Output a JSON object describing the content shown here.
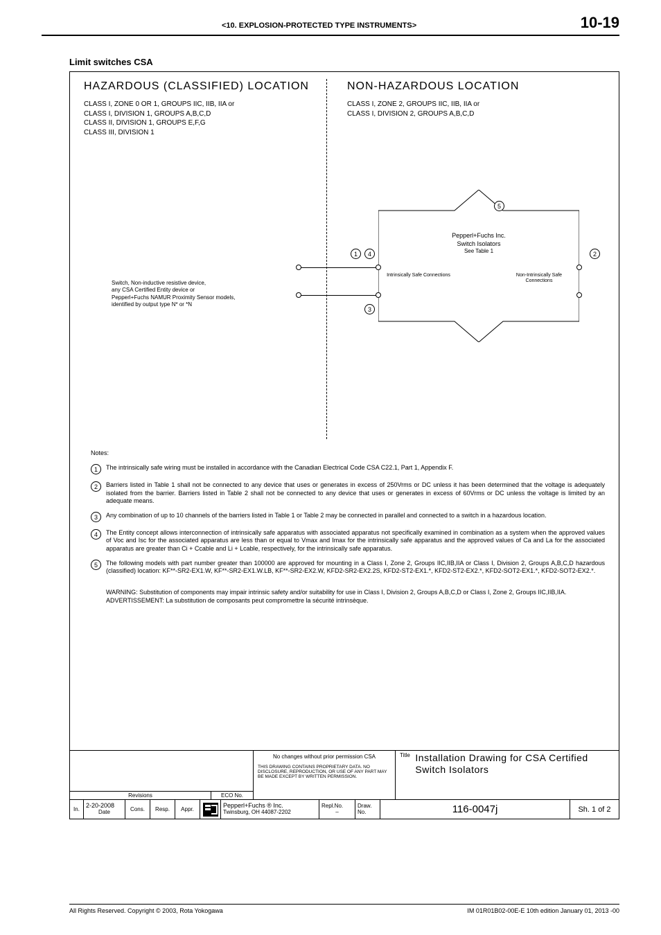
{
  "header": {
    "section": "<10. EXPLOSION-PROTECTED TYPE INSTRUMENTS>",
    "page": "10-19"
  },
  "title": "Limit switches CSA",
  "diagram": {
    "left_title": "HAZARDOUS (CLASSIFIED) LOCATION",
    "left_classes": [
      "CLASS I, ZONE 0 OR 1, GROUPS IIC, IIB, IIA or",
      "CLASS I, DIVISION 1, GROUPS A,B,C,D",
      "CLASS II, DIVISION 1, GROUPS E,F,G",
      "CLASS III, DIVISION 1"
    ],
    "switch_desc": [
      "Switch, Non-inductive resistive device,",
      "any CSA Certified Entity device or",
      "Pepperl+Fuchs NAMUR Proximity Sensor models,",
      "identified by output type N* or *N"
    ],
    "right_title": "NON-HAZARDOUS LOCATION",
    "right_classes": [
      "CLASS I, ZONE 2, GROUPS IIC, IIB, IIA or",
      "CLASS I, DIVISION 2, GROUPS A,B,C,D"
    ],
    "iso_line1": "Pepperl+Fuchs Inc.",
    "iso_line2": "Switch Isolators",
    "iso_see": "See Table 1",
    "conn_left": "Intrinsically Safe Connections",
    "conn_right": "Non-Intrinsically Safe Connections",
    "callouts": {
      "c1": "1",
      "c2": "2",
      "c3": "3",
      "c4": "4",
      "c5": "5"
    }
  },
  "notes": {
    "title": "Notes:",
    "items": [
      {
        "n": "1",
        "t": "The intrinsically safe wiring must be installed in accordance with the Canadian Electrical Code CSA C22.1, Part 1, Appendix F."
      },
      {
        "n": "2",
        "t": "Barriers listed in Table 1 shall not be connected to any device that uses or generates in excess of 250Vrms or DC unless it has been determined that the voltage is adequately isolated from the barrier. Barriers listed in Table 2 shall not be connected to any device that uses or generates in excess of 60Vrms or DC unless the voltage is limited by an adequate means."
      },
      {
        "n": "3",
        "t": "Any combination of up to 10 channels of the barriers listed in Table 1 or Table 2 may be connected in parallel and connected to a switch in a hazardous location."
      },
      {
        "n": "4",
        "t": "The Entity concept allows interconnection of intrinsically safe apparatus with associated apparatus not specifically examined in combination as a system when the approved values of Voc and Isc for the associated apparatus are less than or equal to Vmax and Imax for the intrinsically safe apparatus and the approved values of Ca and La for the associated apparatus are greater than Ci + Ccable and Li + Lcable, respectively, for the intrinsically safe apparatus."
      },
      {
        "n": "5",
        "t": "The following models with part number greater than 100000 are approved for mounting in a Class I, Zone 2, Groups IIC,IIB,IIA or Class I, Division 2, Groups A,B,C,D hazardous (classified) location: KF**-SR2-EX1.W, KF**-SR2-EX1.W.LB, KF**-SR2-EX2.W, KFD2-SR2-EX2.2S, KFD2-ST2-EX1.*, KFD2-ST2-EX2.*, KFD2-SOT2-EX1.*, KFD2-SOT2-EX2.*."
      }
    ],
    "warning": "WARNING: Substitution of components may impair intrinsic safety and/or suitability for use in Class I, Division 2, Groups A,B,C,D or Class I, Zone 2, Groups IIC,IIB,IIA.",
    "advert": "ADVERTISSEMENT: La substitution de composants peut compromettre la sécurité intrinsèque."
  },
  "titleblock": {
    "no_changes": "No changes without prior permission CSA",
    "proprietary": "THIS DRAWING CONTAINS PROPRIETARY DATA. NO DISCLOSURE, REPRODUCTION, OR USE OF ANY PART MAY BE MADE EXCEPT BY WRITTEN PERMISSION.",
    "title_label": "Title",
    "title_value": "Installation Drawing for CSA Certified Switch Isolators",
    "revisions_label": "Revisions",
    "eco_label": "ECO No.",
    "row2": {
      "in": "In.",
      "date_label": "Date",
      "date_value": "2-20-2008",
      "cons": "Cons.",
      "resp": "Resp.",
      "appr": "Appr.",
      "company1": "Pepperl+Fuchs ® Inc.",
      "company2": "Twinsburg, OH 44087-2202",
      "repl_label": "Repl.No.",
      "repl_value": "–",
      "draw_label": "Draw. No.",
      "draw_value": "116-0047j",
      "sheet": "Sh. 1 of 2"
    }
  },
  "footer": {
    "left": "All Rights Reserved. Copyright © 2003, Rota Yokogawa",
    "right": "IM 01R01B02-00E-E   10th edition January 01, 2013 -00"
  }
}
